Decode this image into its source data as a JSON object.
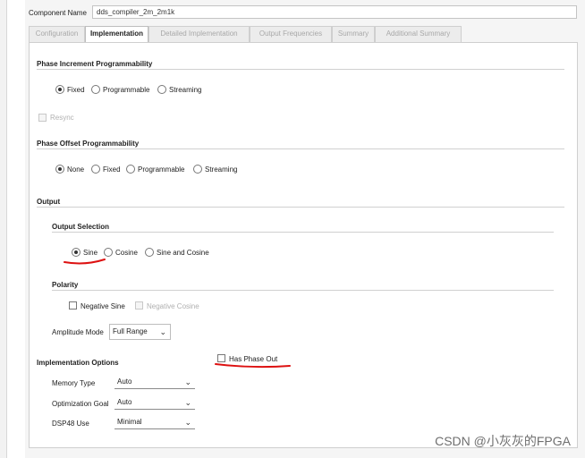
{
  "component": {
    "label": "Component Name",
    "value": "dds_compiler_2m_2m1k"
  },
  "tabs": [
    {
      "label": "Configuration"
    },
    {
      "label": "Implementation"
    },
    {
      "label": "Detailed Implementation"
    },
    {
      "label": "Output Frequencies"
    },
    {
      "label": "Summary"
    },
    {
      "label": "Additional Summary"
    }
  ],
  "phase_increment": {
    "title": "Phase Increment Programmability",
    "options": [
      "Fixed",
      "Programmable",
      "Streaming"
    ],
    "selected": "Fixed",
    "resync_label": "Resync"
  },
  "phase_offset": {
    "title": "Phase Offset Programmability",
    "options": [
      "None",
      "Fixed",
      "Programmable",
      "Streaming"
    ],
    "selected": "None"
  },
  "output": {
    "title": "Output",
    "selection_title": "Output Selection",
    "options": [
      "Sine",
      "Cosine",
      "Sine and Cosine"
    ],
    "selected": "Sine",
    "polarity_title": "Polarity",
    "negative_sine": "Negative Sine",
    "negative_cosine": "Negative Cosine",
    "amplitude_label": "Amplitude Mode",
    "amplitude_value": "Full Range"
  },
  "impl": {
    "title": "Implementation Options",
    "has_phase_out": "Has Phase Out",
    "memory_type_label": "Memory Type",
    "memory_type_value": "Auto",
    "opt_goal_label": "Optimization Goal",
    "opt_goal_value": "Auto",
    "dsp_label": "DSP48 Use",
    "dsp_value": "Minimal"
  },
  "watermark": "CSDN @小灰灰的FPGA",
  "colors": {
    "annotation_red": "#dd1111",
    "active_tab_bg": "#ffffff"
  }
}
